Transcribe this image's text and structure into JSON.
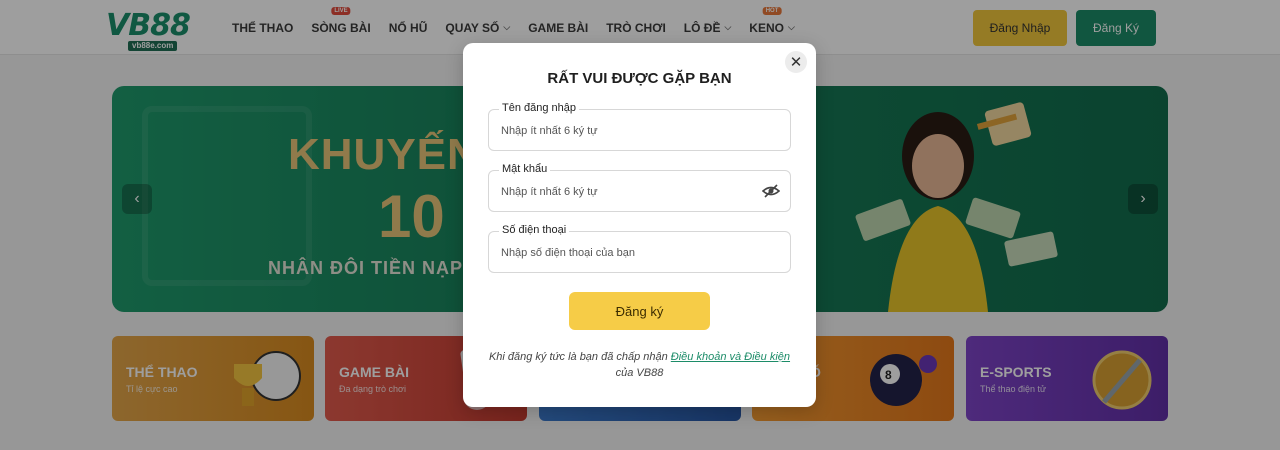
{
  "brand": {
    "logo_text": "VB88",
    "domain": "vb88e.com"
  },
  "nav": [
    {
      "label": "THỂ THAO",
      "badge": "",
      "chevron": false
    },
    {
      "label": "SÒNG BÀI",
      "badge": "LIVE",
      "chevron": false
    },
    {
      "label": "NỔ HŨ",
      "badge": "",
      "chevron": false
    },
    {
      "label": "QUAY SỐ",
      "badge": "",
      "chevron": true
    },
    {
      "label": "GAME BÀI",
      "badge": "",
      "chevron": false
    },
    {
      "label": "TRÒ CHƠI",
      "badge": "",
      "chevron": false
    },
    {
      "label": "LÔ ĐỀ",
      "badge": "",
      "chevron": true
    },
    {
      "label": "KENO",
      "badge": "HOT",
      "chevron": true
    }
  ],
  "header": {
    "login_label": "Đăng Nhập",
    "register_label": "Đăng Ký"
  },
  "banner": {
    "line1": "KHUYẾN",
    "line2": "10",
    "line3": "NHÂN ĐÔI TIỀN NẠP L"
  },
  "categories": [
    {
      "title": "THỂ THAO",
      "subtitle": "Tỉ lệ cực cao",
      "color": "#e0a23a"
    },
    {
      "title": "GAME BÀI",
      "subtitle": "Đa dạng trò chơi",
      "color": "#d94a3d"
    },
    {
      "title": "",
      "subtitle": "",
      "color": "#2f6fc1"
    },
    {
      "title": "Ố",
      "subtitle": "",
      "color": "#ef8c24"
    },
    {
      "title": "E-SPORTS",
      "subtitle": "Thể thao điện tử",
      "color": "#7a3fc3"
    }
  ],
  "modal": {
    "title": "RẤT VUI ĐƯỢC GẶP BẠN",
    "close_symbol": "✕",
    "fields": {
      "username": {
        "label": "Tên đăng nhập",
        "placeholder": "Nhập ít nhất 6 ký tự"
      },
      "password": {
        "label": "Mật khẩu",
        "placeholder": "Nhập ít nhất 6 ký tự"
      },
      "phone": {
        "label": "Số điện thoại",
        "placeholder": "Nhập số điện thoại của bạn"
      }
    },
    "submit_label": "Đăng ký",
    "terms_prefix": "Khi đăng ký tức là bạn đã chấp nhận",
    "terms_link": "Điều khoản và Điều kiện",
    "terms_suffix": "của VB88"
  },
  "colors": {
    "brand_green": "#1c8c68",
    "brand_yellow": "#f6cc47"
  }
}
